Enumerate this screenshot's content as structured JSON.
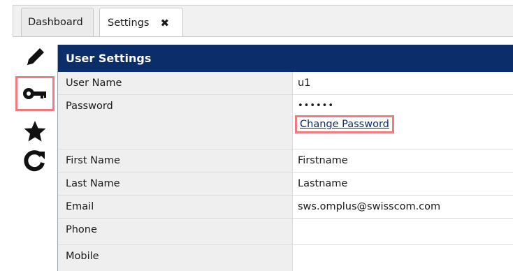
{
  "tabs": [
    {
      "label": "Dashboard"
    },
    {
      "label": "Settings",
      "close_glyph": "✖"
    }
  ],
  "toolbar": {
    "tools": [
      {
        "icon": "pencil-icon"
      },
      {
        "icon": "key-icon"
      },
      {
        "icon": "star-icon"
      },
      {
        "icon": "refresh-icon"
      }
    ]
  },
  "panel": {
    "title": "User Settings",
    "rows": [
      {
        "label": "User Name",
        "value": "u1"
      },
      {
        "label": "Password",
        "value": "••••••",
        "action": "Change Password"
      },
      {
        "label": "First Name",
        "value": "Firstname"
      },
      {
        "label": "Last Name",
        "value": "Lastname"
      },
      {
        "label": "Email",
        "value": "sws.omplus@swisscom.com"
      },
      {
        "label": "Phone",
        "value": ""
      },
      {
        "label": "Mobile",
        "value": ""
      }
    ]
  },
  "colors": {
    "header": "#0b2d6a",
    "highlight": "#f07a7e",
    "label_bg": "#efefef"
  }
}
